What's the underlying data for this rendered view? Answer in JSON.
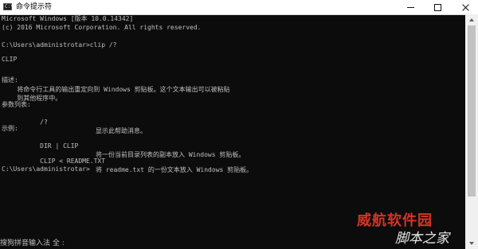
{
  "window": {
    "title": "命令提示符",
    "app_icon_glyph": "C:\\_"
  },
  "console": {
    "lines": {
      "l1": "Microsoft Windows [版本 10.0.14342]",
      "l2": "(c) 2016 Microsoft Corporation. All rights reserved.",
      "l3": "C:\\Users\\administrotar>clip /?",
      "l4": "CLIP",
      "l5": "描述:",
      "l6": "    将命令行工具的输出重定向到 Windows 剪贴板。这个文本输出可以被粘贴",
      "l7": "    到其他程序中。",
      "l8": "参数列表:",
      "l9_cmd": "    /?",
      "l9_desc": "显示此帮助消息。",
      "l10": "示例:",
      "l11_cmd": "    DIR | CLIP",
      "l11_desc": "将一份当前目录列表的副本放入 Windows 剪贴板。",
      "l12_cmd": "    CLIP < README.TXT",
      "l12_desc": "将 readme.txt 的一份文本放入 Windows 剪贴板。",
      "l13": "C:\\Users\\administrotar>"
    }
  },
  "ime": {
    "status": "搜狗拼音输入法 全 :"
  },
  "watermark": {
    "top": "威航软件园",
    "bottom": "脚本之家"
  },
  "colors": {
    "console_bg": "#0c0c0c",
    "console_text": "#c0c0c0",
    "titlebar_bg": "#ffffff",
    "watermark_red": "#e8392b"
  }
}
